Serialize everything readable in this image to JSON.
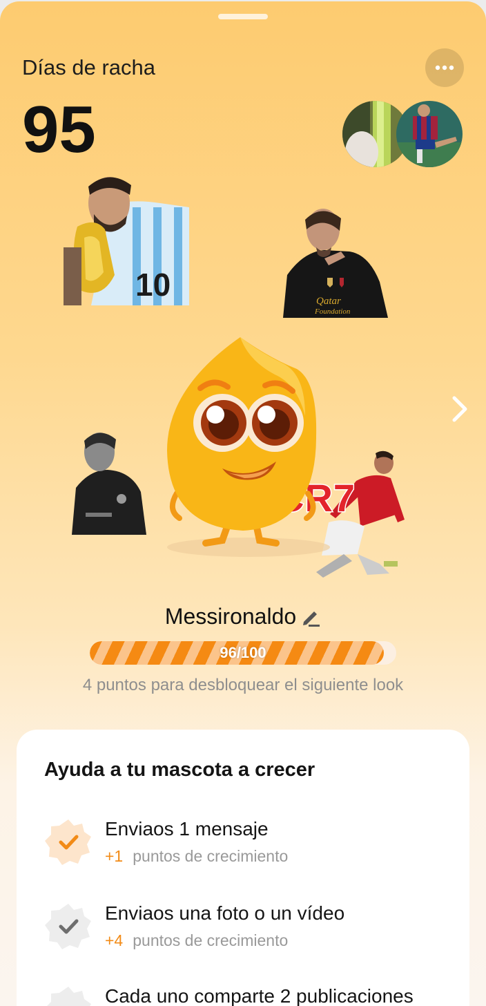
{
  "streak": {
    "label": "Días de racha",
    "count": "95"
  },
  "pet": {
    "name": "Messironaldo",
    "progress": {
      "text": "96/100",
      "current": 96,
      "max": 100
    },
    "hint": "4 puntos para desbloquear el siguiente look"
  },
  "stickers": {
    "cr7_text": "CR7"
  },
  "tasks_card": {
    "title": "Ayuda a tu mascota a crecer",
    "tasks": [
      {
        "title": "Enviaos 1 mensaje",
        "points": "+1",
        "points_label": "puntos de crecimiento",
        "completed": true
      },
      {
        "title": "Enviaos una foto o un vídeo",
        "points": "+4",
        "points_label": "puntos de crecimiento",
        "completed": false
      },
      {
        "title": "Cada uno comparte 2 publicaciones",
        "points": "",
        "points_label": "",
        "completed": false
      }
    ]
  },
  "colors": {
    "accent": "#f58a13",
    "badge_done": "#f28b17",
    "badge_pending": "#6e6e6e"
  },
  "icons": {
    "more": "more-horizontal-icon",
    "next": "chevron-right-icon",
    "edit": "pencil-icon",
    "done": "check-icon"
  }
}
